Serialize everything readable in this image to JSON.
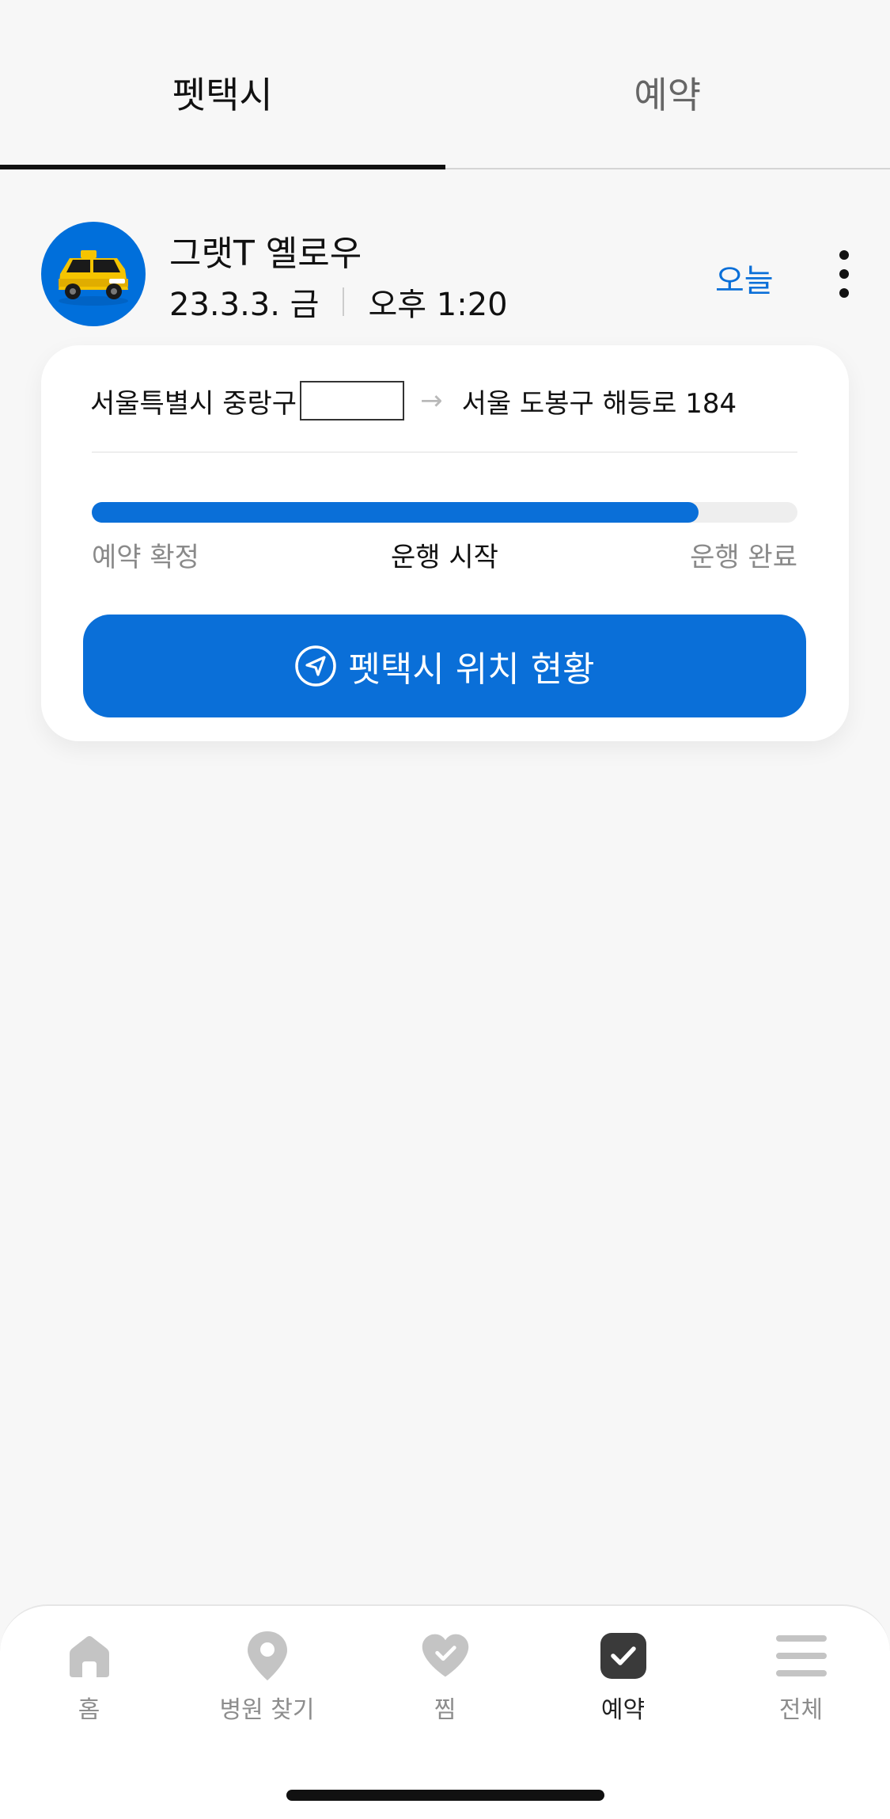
{
  "tabs": [
    {
      "label": "펫택시",
      "active": true
    },
    {
      "label": "예약",
      "active": false
    }
  ],
  "ride": {
    "title": "그랫T 옐로우",
    "date": "23.3.3. 금",
    "time": "오후 1:20",
    "today_label": "오늘",
    "avatar_icon": "yellow-taxi-icon"
  },
  "route": {
    "origin": "서울특별시 중랑구",
    "destination": "서울 도봉구 해등로 184"
  },
  "progress": {
    "fraction": 0.86,
    "steps": [
      "예약 확정",
      "운행 시작",
      "운행 완료"
    ],
    "current_step": 1
  },
  "location_button": {
    "label": "펫택시 위치 현황",
    "icon": "navigation-arrow-icon"
  },
  "bottom_nav": [
    {
      "label": "홈",
      "icon": "home-icon",
      "active": false
    },
    {
      "label": "병원 찾기",
      "icon": "location-pin-icon",
      "active": false
    },
    {
      "label": "찜",
      "icon": "heart-check-icon",
      "active": false
    },
    {
      "label": "예약",
      "icon": "checkbox-icon",
      "active": true
    },
    {
      "label": "전체",
      "icon": "menu-icon",
      "active": false
    }
  ],
  "colors": {
    "accent": "#0a6fd8",
    "background": "#f7f7f7",
    "avatar_bg": "#006fdb",
    "taxi_yellow": "#f5c400"
  }
}
